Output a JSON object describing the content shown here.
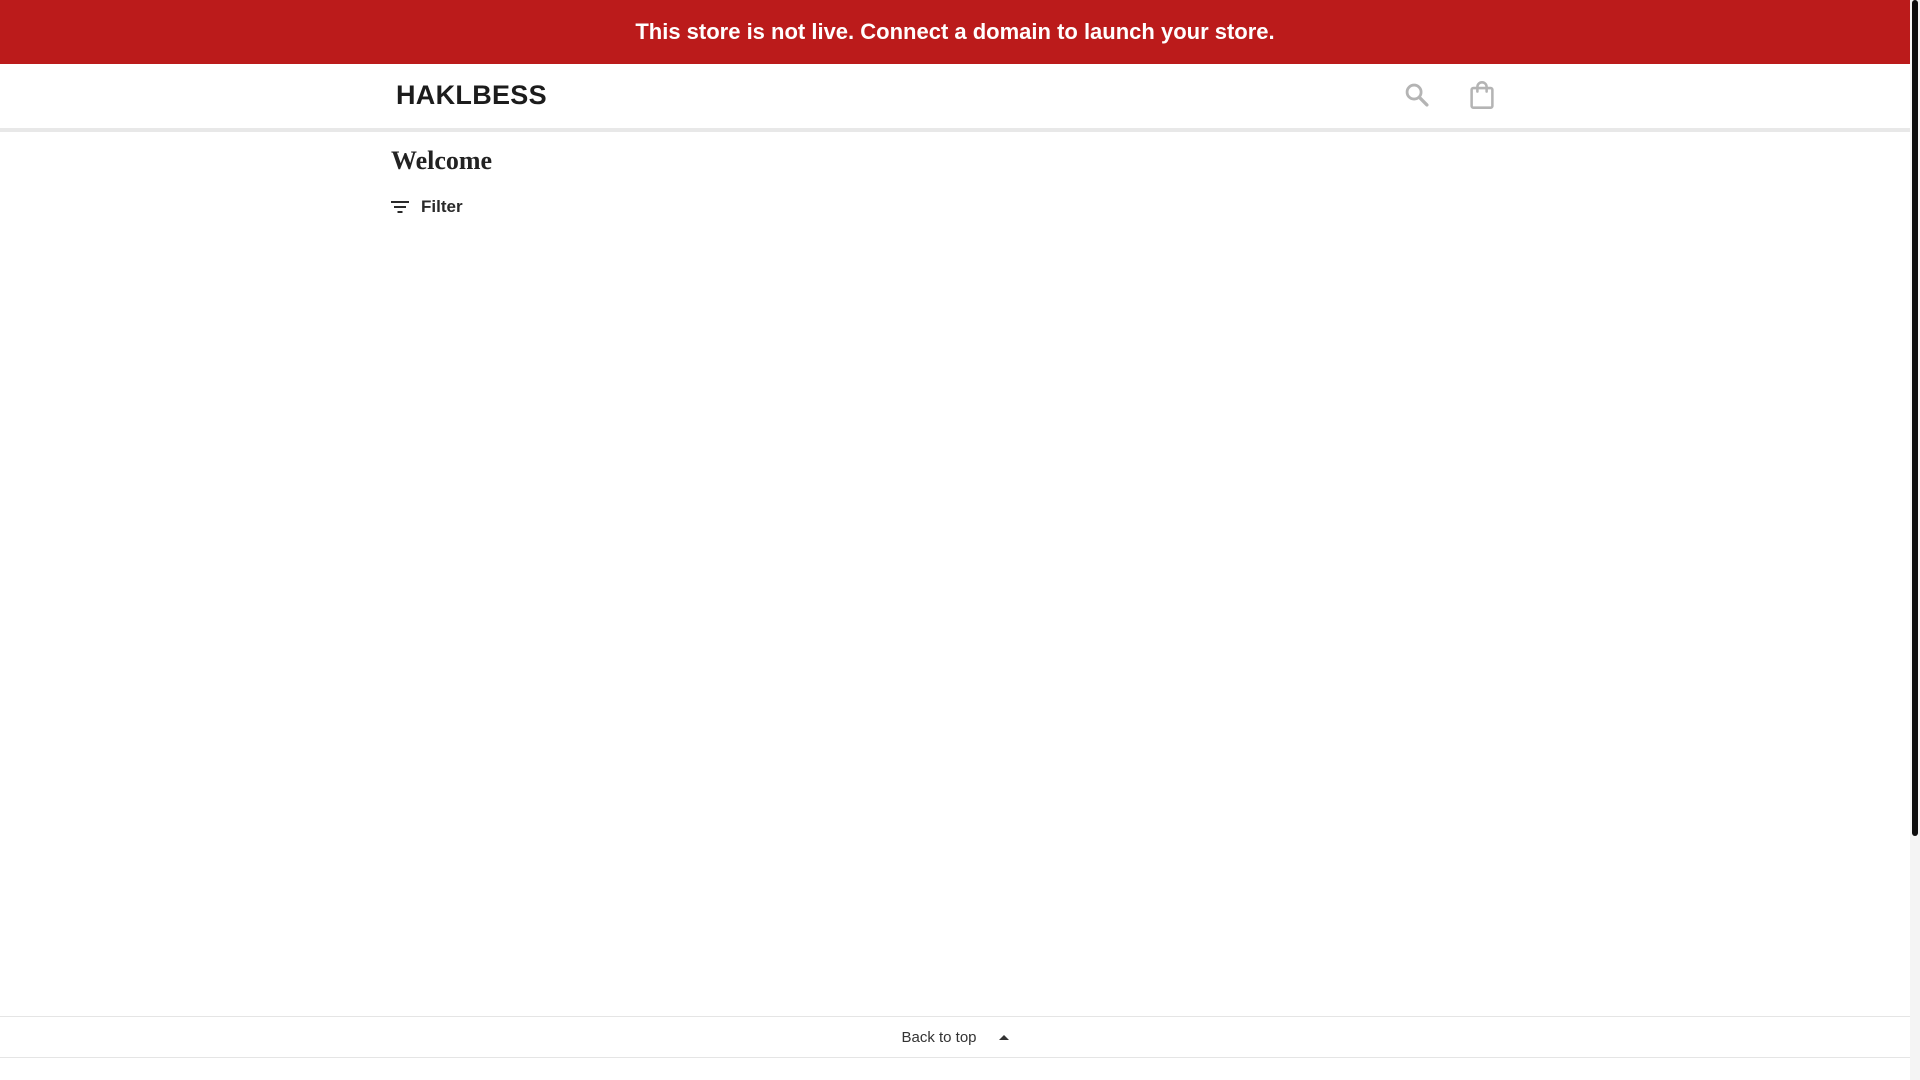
{
  "announcement": {
    "text": "This store is not live. Connect a domain to launch your store.",
    "background_color": "#bb1b1b"
  },
  "header": {
    "logo": "HAKLBESS",
    "icons": {
      "search": "search-icon",
      "cart": "shopping-bag-icon",
      "icon_color": "#b4b4b4"
    }
  },
  "main": {
    "title": "Welcome",
    "filter_label": "Filter",
    "filter_icon": "filter-icon"
  },
  "footer": {
    "back_to_top": "Back to top",
    "arrow_icon": "caret-up-icon"
  }
}
